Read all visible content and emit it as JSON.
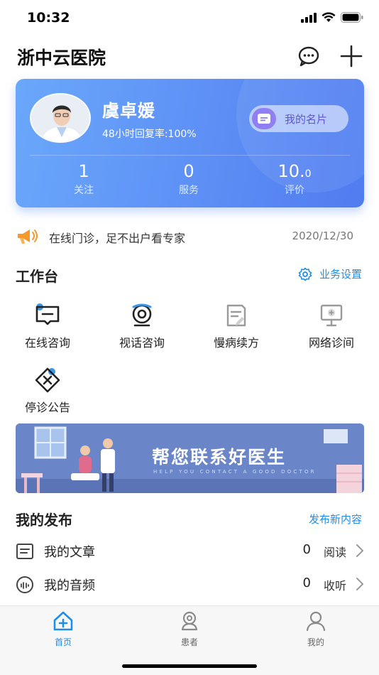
{
  "status_bar": {
    "time": "10:32"
  },
  "header": {
    "title": "浙中云医院"
  },
  "profile": {
    "name": "虞卓媛",
    "reply_rate": "48小时回复率:100%",
    "card_button": "我的名片",
    "stats": [
      {
        "value": "1",
        "label": "关注"
      },
      {
        "value": "0",
        "label": "服务"
      },
      {
        "value": "10.",
        "value_small": "0",
        "label": "评价"
      }
    ]
  },
  "notice": {
    "text": "在线门诊，足不出户看专家",
    "date": "2020/12/30"
  },
  "workbench": {
    "title": "工作台",
    "settings_label": "业务设置",
    "tools": [
      {
        "label": "在线咨询",
        "icon": "chat-box-icon"
      },
      {
        "label": "视话咨询",
        "icon": "webcam-icon"
      },
      {
        "label": "慢病续方",
        "icon": "prescription-icon"
      },
      {
        "label": "网络诊间",
        "icon": "monitor-icon"
      },
      {
        "label": "停诊公告",
        "icon": "cancel-badge-icon"
      }
    ]
  },
  "banner": {
    "title": "帮您联系好医生",
    "subtitle": "HELP YOU CONTACT A GOOD DOCTOR"
  },
  "publish": {
    "title": "我的发布",
    "new_link": "发布新内容",
    "items": [
      {
        "label": "我的文章",
        "count": "0",
        "unit": "阅读",
        "icon": "article-icon"
      },
      {
        "label": "我的音频",
        "count": "0",
        "unit": "收听",
        "icon": "audio-icon"
      }
    ]
  },
  "tabs": [
    {
      "label": "首页",
      "active": true
    },
    {
      "label": "患者",
      "active": false
    },
    {
      "label": "我的",
      "active": false
    }
  ],
  "colors": {
    "accent": "#1e8ee6",
    "card_blue": "#5d8ff5",
    "tab_active": "#1e8ee6",
    "tab_inactive": "#8a8a8a"
  }
}
